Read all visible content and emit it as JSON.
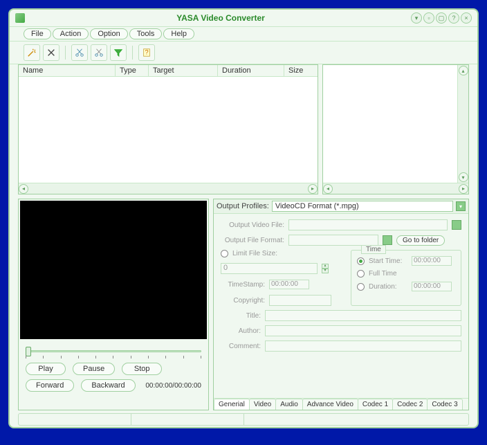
{
  "window": {
    "title": "YASA Video Converter"
  },
  "menu": {
    "file": "File",
    "action": "Action",
    "option": "Option",
    "tools": "Tools",
    "help": "Help"
  },
  "columns": {
    "name": "Name",
    "type": "Type",
    "target": "Target",
    "duration": "Duration",
    "size": "Size"
  },
  "player": {
    "play": "Play",
    "pause": "Pause",
    "stop": "Stop",
    "forward": "Forward",
    "backward": "Backward",
    "timecode": "00:00:00/00:00:00"
  },
  "profiles": {
    "label": "Output Profiles:",
    "selected": "VideoCD Format (*.mpg)"
  },
  "settings": {
    "output_video_file": "Output Video File:",
    "output_file_format": "Output File Format:",
    "go_to_folder": "Go to folder",
    "limit_file_size": "Limit File Size:",
    "filesize_value": "0",
    "timestamp": "TimeStamp:",
    "timestamp_value": "00:00:00",
    "copyright": "Copyright:",
    "title": "Title:",
    "author": "Author:",
    "comment": "Comment:",
    "time": {
      "legend": "Time",
      "start_time": "Start Time:",
      "start_value": "00:00:00",
      "full_time": "Full Time",
      "duration": "Duration:",
      "duration_value": "00:00:00"
    }
  },
  "tabs": {
    "general": "Generial",
    "video": "Video",
    "audio": "Audio",
    "advance": "Advance Video",
    "codec1": "Codec 1",
    "codec2": "Codec 2",
    "codec3": "Codec 3"
  }
}
